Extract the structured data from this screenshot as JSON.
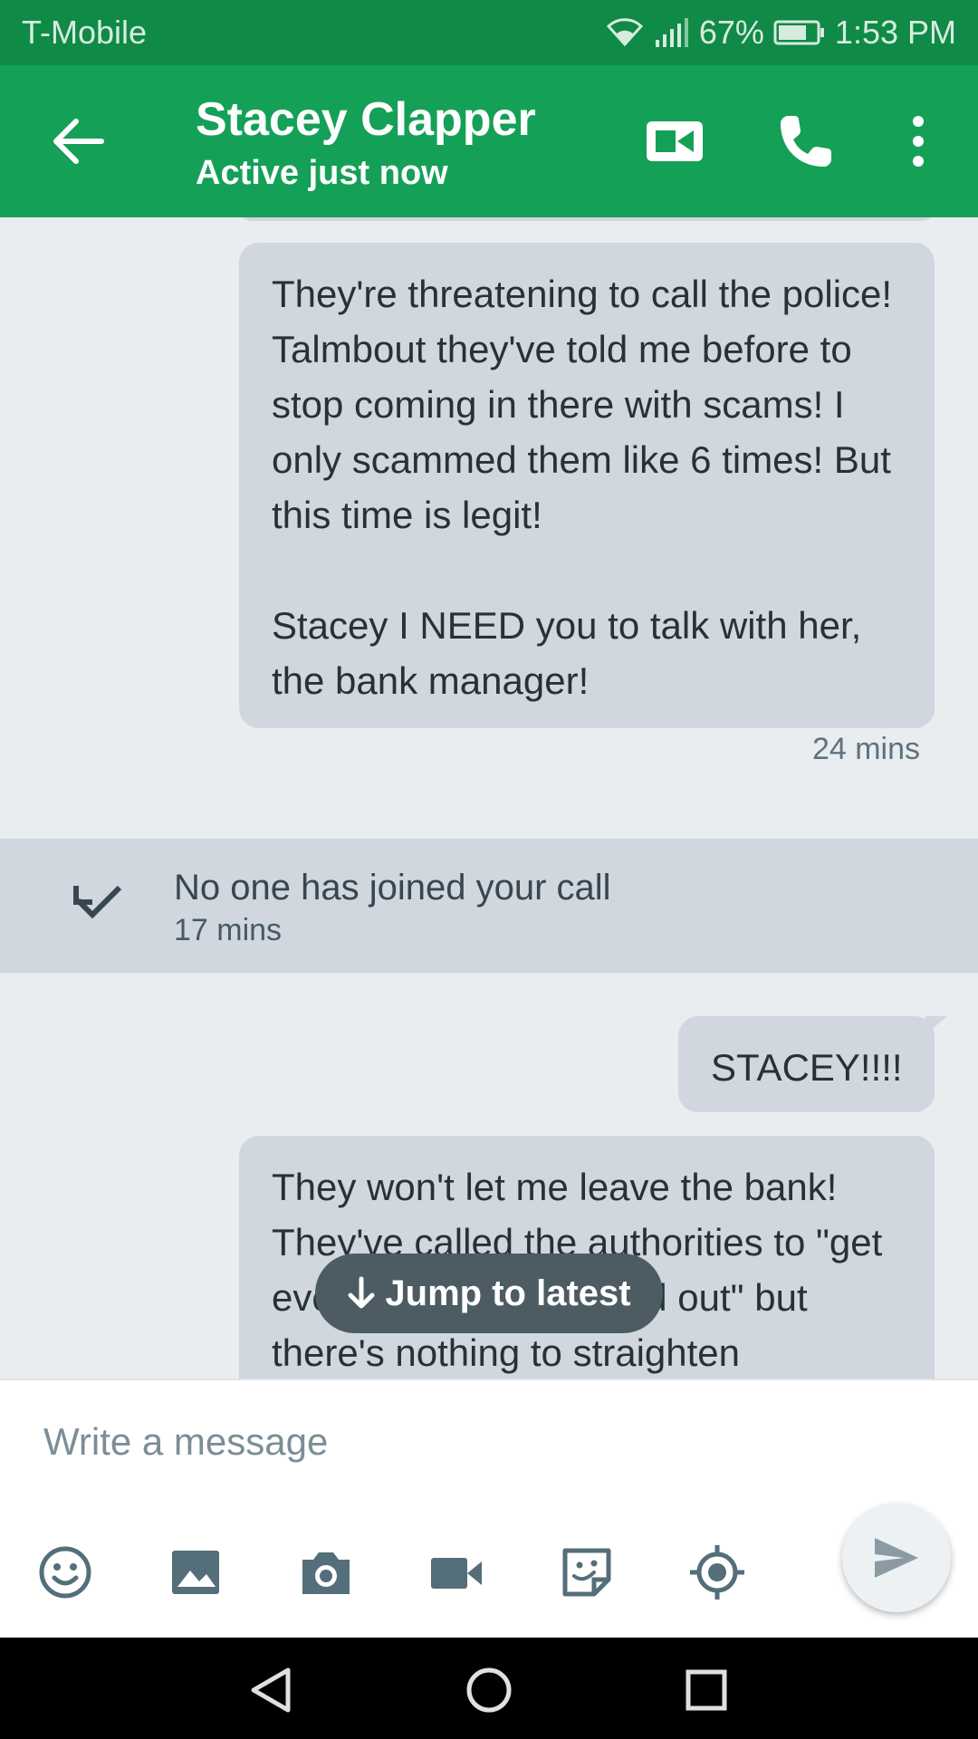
{
  "status_bar": {
    "carrier": "T-Mobile",
    "battery": "67%",
    "time": "1:53 PM"
  },
  "header": {
    "contact_name": "Stacey Clapper",
    "status": "Active just now",
    "icons": [
      "back-arrow-icon",
      "video-call-icon",
      "phone-call-icon",
      "more-vert-icon"
    ]
  },
  "messages": [
    {
      "text": "They're threatening to call the police! Talmbout they've told me before to stop coming in there with scams! I only scammed them like 6 times! But this time is legit!\n\nStacey I NEED you to talk with her, the bank manager!",
      "time": "24 mins"
    },
    {
      "text": "STACEY!!!!"
    },
    {
      "text": "They won't let me leave the bank! They've called the authorities to \"get everything straightened out\" but there's nothing to straighten"
    }
  ],
  "call_event": {
    "text": "No one has joined your call",
    "time": "17 mins",
    "icon": "missed-call-icon"
  },
  "jump_button": {
    "label": "Jump to latest"
  },
  "composer": {
    "placeholder": "Write a message",
    "tools": [
      "emoji-icon",
      "image-icon",
      "camera-icon",
      "video-icon",
      "sticker-icon",
      "location-icon"
    ],
    "send_icon": "send-icon"
  },
  "colors": {
    "header_green": "#15a058",
    "status_green": "#0f8a47",
    "bubble": "#d0d7de",
    "background": "#e9edf0"
  }
}
